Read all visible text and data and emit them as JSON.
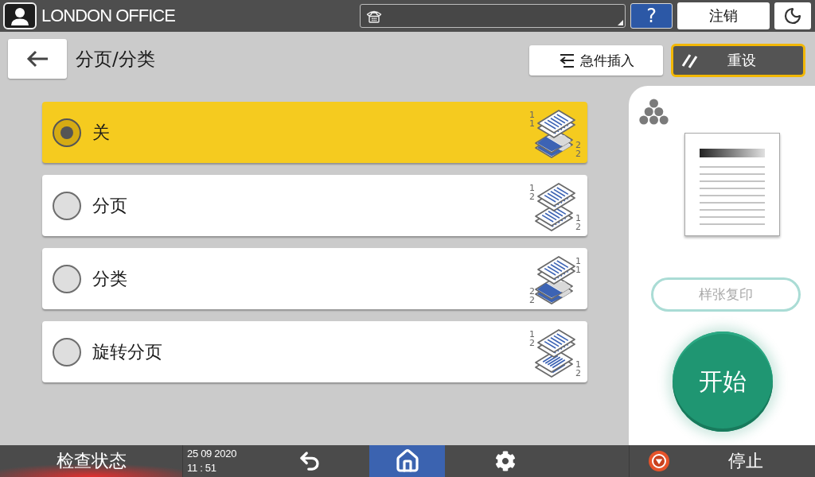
{
  "top_bar": {
    "user_name": "LONDON OFFICE",
    "help_button": "?",
    "logout_button": "注销"
  },
  "header": {
    "title": "分页/分类",
    "interrupt_button": "急件插入",
    "reset_button": {
      "label": "重设",
      "highlighted": true
    }
  },
  "options": [
    {
      "kind": "off",
      "label": "关",
      "selected": true,
      "icon_numbers": [
        "1",
        "1",
        "2",
        "2"
      ]
    },
    {
      "kind": "sort",
      "label": "分页",
      "selected": false,
      "icon_numbers": [
        "1",
        "2",
        "1",
        "2"
      ]
    },
    {
      "kind": "stack",
      "label": "分类",
      "selected": false,
      "icon_numbers": [
        "1",
        "1",
        "2",
        "2"
      ]
    },
    {
      "kind": "rotate_sort",
      "label": "旋转分页",
      "selected": false,
      "icon_numbers": [
        "1",
        "2",
        "1",
        "2"
      ]
    }
  ],
  "side_panel": {
    "sample_copy_button": {
      "label": "样张复印",
      "disabled": true
    },
    "start_button": "开始"
  },
  "bottom_bar": {
    "status_button": {
      "label": "检查状态",
      "alert": true
    },
    "date": "25 09 2020",
    "time": "11 : 51",
    "nav_buttons": [
      {
        "kind": "back",
        "selected": false
      },
      {
        "kind": "home",
        "selected": true
      },
      {
        "kind": "settings",
        "selected": false
      }
    ],
    "stop_button": "停止"
  }
}
